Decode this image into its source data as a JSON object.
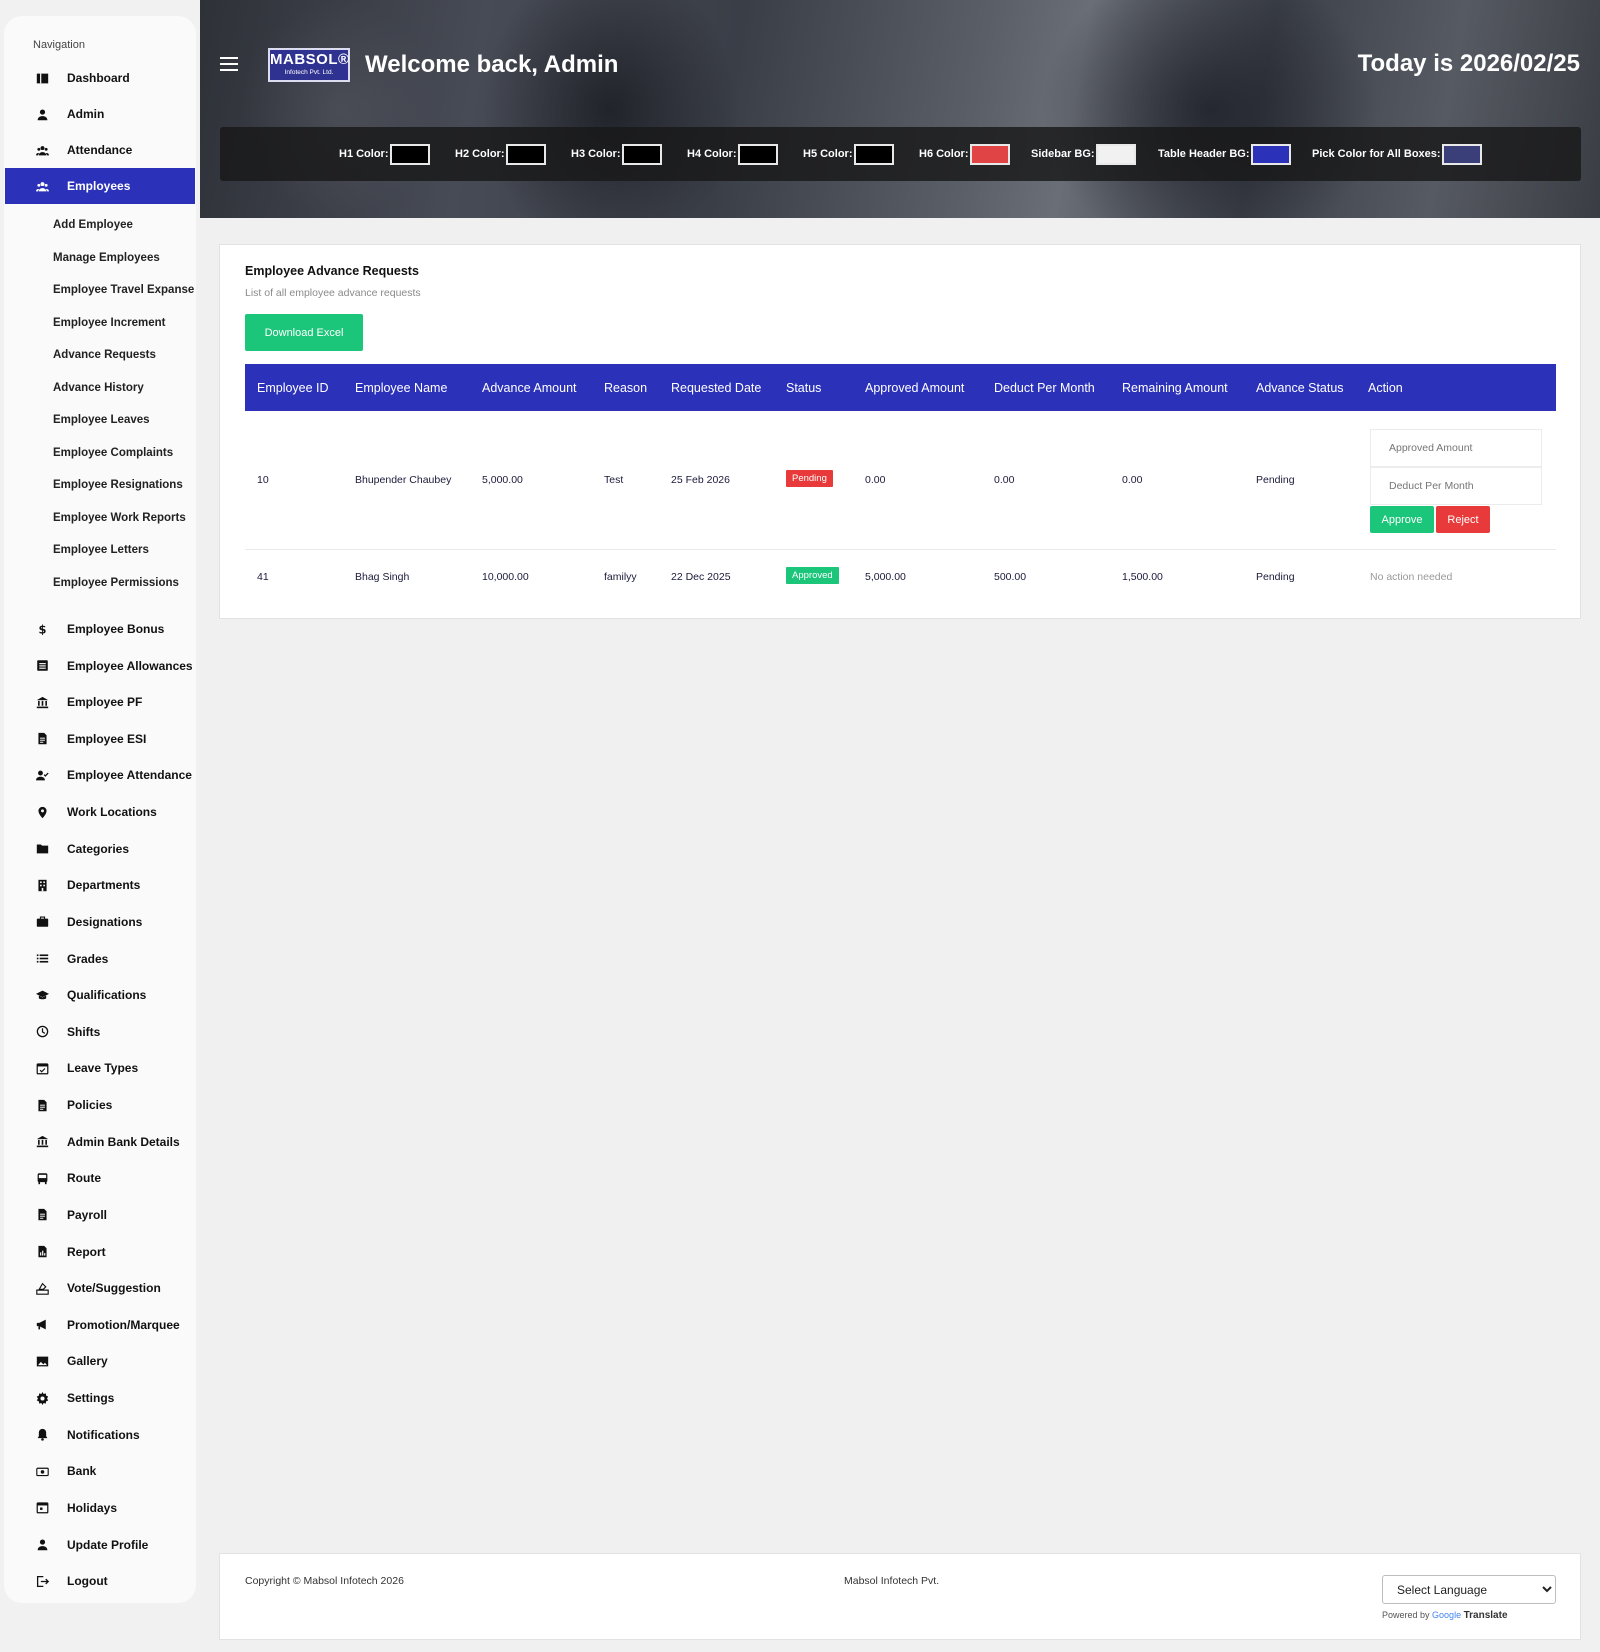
{
  "sidebar": {
    "heading": "Navigation",
    "top_items": [
      {
        "label": "Dashboard",
        "icon": "dashboard-icon"
      },
      {
        "label": "Admin",
        "icon": "user-icon"
      },
      {
        "label": "Attendance",
        "icon": "group-icon"
      },
      {
        "label": "Employees",
        "icon": "group-icon",
        "active": true
      }
    ],
    "employee_submenu": [
      "Add Employee",
      "Manage Employees",
      "Employee Travel Expanse",
      "Employee Increment",
      "Advance Requests",
      "Advance History",
      "Employee Leaves",
      "Employee Complaints",
      "Employee Resignations",
      "Employee Work Reports",
      "Employee Letters",
      "Employee Permissions"
    ],
    "bottom_items": [
      {
        "label": "Employee Bonus",
        "icon": "dollar-icon"
      },
      {
        "label": "Employee Allowances",
        "icon": "list-box-icon"
      },
      {
        "label": "Employee PF",
        "icon": "bank-icon"
      },
      {
        "label": "Employee ESI",
        "icon": "document-icon"
      },
      {
        "label": "Employee Attendance",
        "icon": "user-check-icon"
      },
      {
        "label": "Work Locations",
        "icon": "location-pin-icon"
      },
      {
        "label": "Categories",
        "icon": "folder-icon"
      },
      {
        "label": "Departments",
        "icon": "building-icon"
      },
      {
        "label": "Designations",
        "icon": "briefcase-icon"
      },
      {
        "label": "Grades",
        "icon": "list-icon"
      },
      {
        "label": "Qualifications",
        "icon": "graduation-cap-icon"
      },
      {
        "label": "Shifts",
        "icon": "clock-icon"
      },
      {
        "label": "Leave Types",
        "icon": "calendar-check-icon"
      },
      {
        "label": "Policies",
        "icon": "document-icon"
      },
      {
        "label": "Admin Bank Details",
        "icon": "bank-icon"
      },
      {
        "label": "Route",
        "icon": "bus-icon"
      },
      {
        "label": "Payroll",
        "icon": "document-icon"
      },
      {
        "label": "Report",
        "icon": "report-icon"
      },
      {
        "label": "Vote/Suggestion",
        "icon": "vote-icon"
      },
      {
        "label": "Promotion/Marquee",
        "icon": "megaphone-icon"
      },
      {
        "label": "Gallery",
        "icon": "image-icon"
      },
      {
        "label": "Settings",
        "icon": "gear-icon"
      },
      {
        "label": "Notifications",
        "icon": "bell-icon"
      },
      {
        "label": "Bank",
        "icon": "money-icon"
      },
      {
        "label": "Holidays",
        "icon": "calendar-icon"
      },
      {
        "label": "Update Profile",
        "icon": "user-icon"
      },
      {
        "label": "Logout",
        "icon": "logout-icon"
      }
    ]
  },
  "header": {
    "logo_line1": "MABSOL®",
    "logo_line2": "Infotech Pvt. Ltd.",
    "welcome": "Welcome back, Admin",
    "today": "Today is 2026/02/25",
    "color_pickers": [
      {
        "label": "H1 Color:",
        "color": "#000000"
      },
      {
        "label": "H2 Color:",
        "color": "#000000"
      },
      {
        "label": "H3 Color:",
        "color": "#000000"
      },
      {
        "label": "H4 Color:",
        "color": "#000000"
      },
      {
        "label": "H5 Color:",
        "color": "#000000"
      },
      {
        "label": "H6 Color:",
        "color": "#e04444"
      },
      {
        "label": "Sidebar BG:",
        "color": "#f1f1f1"
      },
      {
        "label": "Table Header BG:",
        "color": "#2b31b8"
      },
      {
        "label": "Pick Color for All Boxes:",
        "color": "#3a3f7a"
      }
    ]
  },
  "main": {
    "title": "Employee Advance Requests",
    "subtitle": "List of all employee advance requests",
    "download_label": "Download Excel",
    "columns": [
      "Employee ID",
      "Employee Name",
      "Advance Amount",
      "Reason",
      "Requested Date",
      "Status",
      "Approved Amount",
      "Deduct Per Month",
      "Remaining Amount",
      "Advance Status",
      "Action"
    ],
    "rows": [
      {
        "employee_id": "10",
        "name": "Bhupender Chaubey",
        "advance_amount": "5,000.00",
        "reason": "Test",
        "requested_date": "25 Feb 2026",
        "status": "Pending",
        "approved_amount": "0.00",
        "deduct_per_month": "0.00",
        "remaining_amount": "0.00",
        "advance_status": "Pending",
        "approved_amount_placeholder": "Approved Amount",
        "deduct_placeholder": "Deduct Per Month",
        "approve_label": "Approve",
        "reject_label": "Reject"
      },
      {
        "employee_id": "41",
        "name": "Bhag Singh",
        "advance_amount": "10,000.00",
        "reason": "familyy",
        "requested_date": "22 Dec 2025",
        "status": "Approved",
        "approved_amount": "5,000.00",
        "deduct_per_month": "500.00",
        "remaining_amount": "1,500.00",
        "advance_status": "Pending",
        "action_text": "No action needed"
      }
    ],
    "colors": {
      "accent": "#2b31b8",
      "success": "#1bc57a",
      "danger": "#e83a3a"
    }
  },
  "footer": {
    "copyright": "Copyright © Mabsol Infotech 2026",
    "company": "Mabsol Infotech Pvt.",
    "language_select": "Select Language",
    "powered_by": "Powered by",
    "google": "Google",
    "translate": "Translate"
  }
}
